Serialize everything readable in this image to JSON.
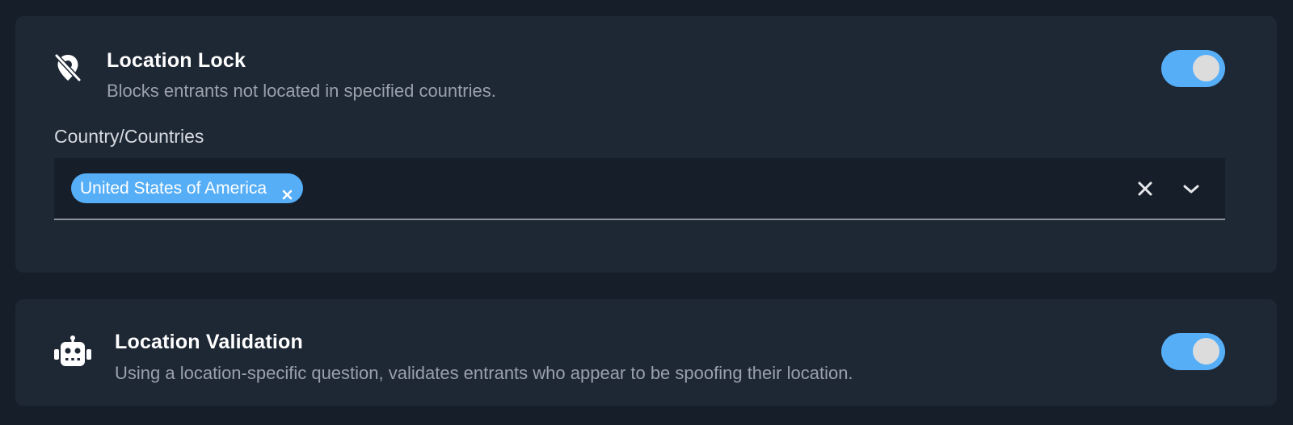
{
  "location_lock": {
    "icon": "location-off-icon",
    "title": "Location Lock",
    "description": "Blocks entrants not located in specified countries.",
    "enabled": true,
    "country_field": {
      "label": "Country/Countries",
      "selected": [
        "United States of America"
      ],
      "clear_icon": "close-icon",
      "dropdown_icon": "chevron-down-icon",
      "remove_chip_icon": "close-icon"
    }
  },
  "location_validation": {
    "icon": "robot-icon",
    "title": "Location Validation",
    "description": "Using a location-specific question, validates entrants who appear to be spoofing their location.",
    "enabled": true
  },
  "colors": {
    "page_background": "#161e2a",
    "card_background": "#1e2734",
    "accent": "#56aef7",
    "toggle_knob": "#dcdcdc",
    "title_text": "#ffffff",
    "description_text": "#9aa1ac"
  }
}
